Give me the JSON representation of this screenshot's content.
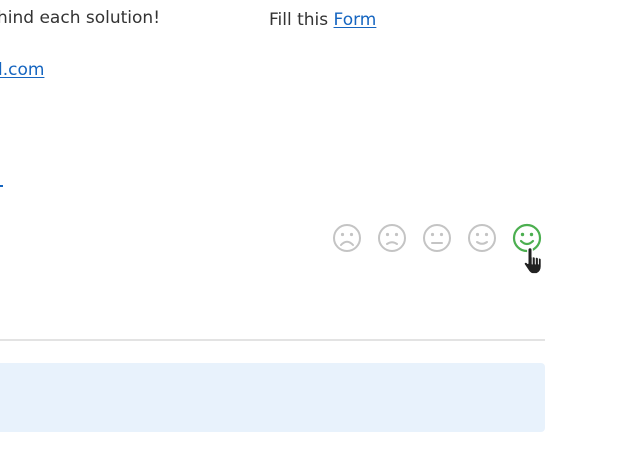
{
  "content": {
    "intro_text": "hind each solution!",
    "fill_prefix": "Fill this",
    "form_link": "Form",
    "email_link": "l.com"
  },
  "rating": {
    "options": [
      {
        "name": "very-dissatisfied",
        "icon": "frowning-face-icon"
      },
      {
        "name": "dissatisfied",
        "icon": "slightly-frowning-face-icon"
      },
      {
        "name": "neutral",
        "icon": "neutral-face-icon"
      },
      {
        "name": "satisfied",
        "icon": "slightly-smiling-face-icon"
      },
      {
        "name": "very-satisfied",
        "icon": "smiling-face-icon"
      }
    ],
    "hovered_index": 4,
    "colors": {
      "default": "#c4c4c4",
      "active": "#4caf50"
    }
  },
  "colors": {
    "link": "#1565c0",
    "text": "#333333",
    "divider": "#e3e3e3",
    "banner_bg": "#e8f2fc"
  }
}
